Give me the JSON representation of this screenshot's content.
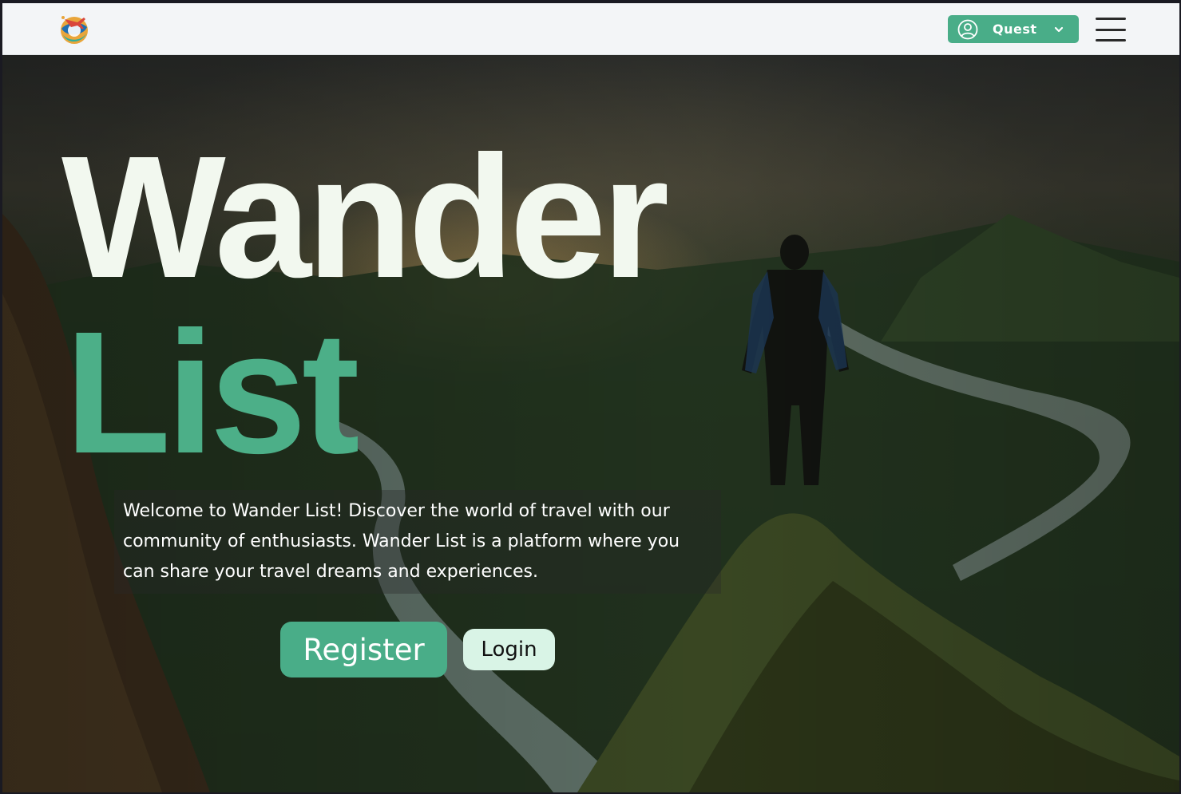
{
  "app": {
    "logo_icon": "globe-plane-logo-icon",
    "colors": {
      "accent": "#49ad88",
      "title_light": "#f2f8ef",
      "login_bg": "#d9f4e6"
    }
  },
  "header": {
    "user_menu": {
      "label": "Quest",
      "icon": "user-circle-icon",
      "dropdown_icon": "chevron-down-icon"
    },
    "menu_icon": "hamburger-menu-icon"
  },
  "hero": {
    "title_line1": "Wander",
    "title_line2": "List",
    "intro": "Welcome to Wander List! Discover the world of travel with our community of enthusiasts. Wander List is a platform where you can share your travel dreams and experiences.",
    "register_label": "Register",
    "login_label": "Login"
  }
}
